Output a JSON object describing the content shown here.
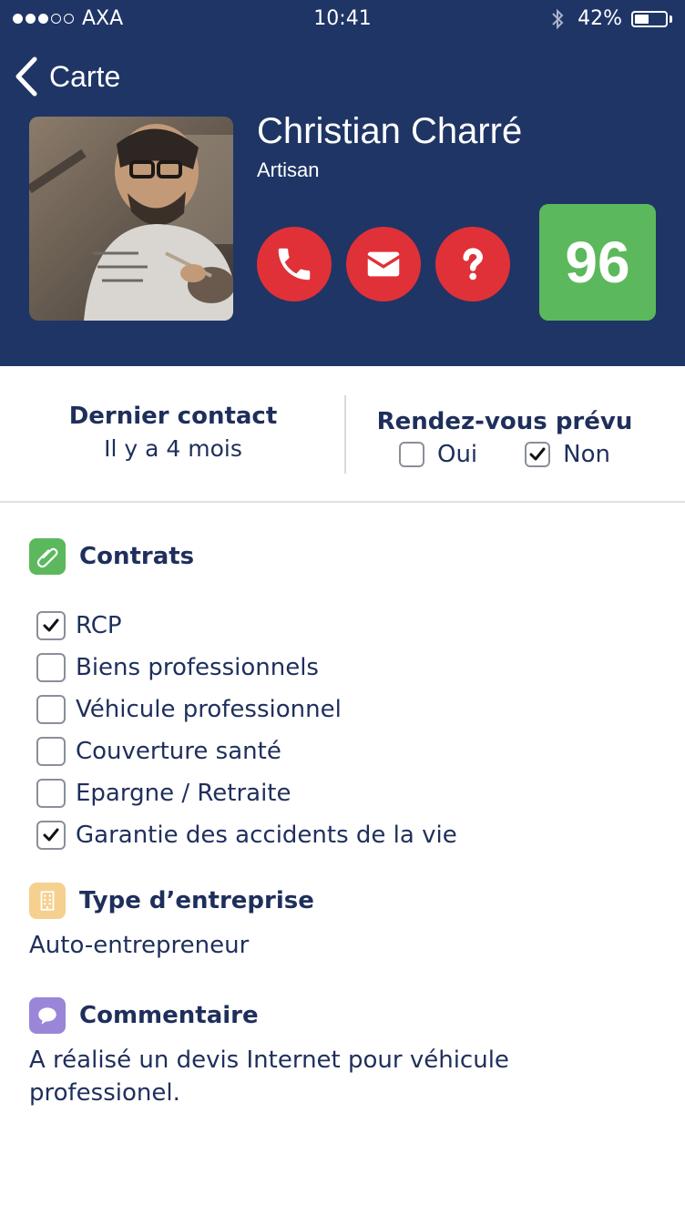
{
  "status_bar": {
    "carrier": "AXA",
    "time": "10:41",
    "battery": "42%",
    "signal_bars_filled": 3,
    "signal_bars_total": 5,
    "battery_level": 0.42
  },
  "nav": {
    "back_label": "Carte"
  },
  "profile": {
    "name": "Christian Charré",
    "role": "Artisan",
    "score": "96",
    "actions": [
      "phone-icon",
      "mail-icon",
      "question-icon"
    ]
  },
  "last_contact": {
    "title": "Dernier contact",
    "value": "Il y a 4 mois"
  },
  "appointment": {
    "title": "Rendez-vous prévu",
    "options": [
      {
        "label": "Oui",
        "checked": false
      },
      {
        "label": "Non",
        "checked": true
      }
    ]
  },
  "contracts": {
    "title": "Contrats",
    "icon": "paperclip-icon",
    "items": [
      {
        "label": "RCP",
        "checked": true
      },
      {
        "label": "Biens professionnels",
        "checked": false
      },
      {
        "label": "Véhicule professionnel",
        "checked": false
      },
      {
        "label": "Couverture santé",
        "checked": false
      },
      {
        "label": "Epargne / Retraite",
        "checked": false
      },
      {
        "label": "Garantie des accidents de la vie",
        "checked": true
      }
    ]
  },
  "company_type": {
    "title": "Type d’entreprise",
    "icon": "building-icon",
    "value": "Auto-entrepreneur"
  },
  "comment": {
    "title": "Commentaire",
    "icon": "speech-bubble-icon",
    "value": "A réalisé un devis Internet pour véhicule professionel."
  },
  "colors": {
    "header_bg": "#1f3566",
    "action_red": "#e03138",
    "score_green": "#5cb85c",
    "contracts_icon": "#5cb85c",
    "company_icon": "#f6d08f",
    "comment_icon": "#9a86d8",
    "text_navy": "#1f2f5c"
  }
}
